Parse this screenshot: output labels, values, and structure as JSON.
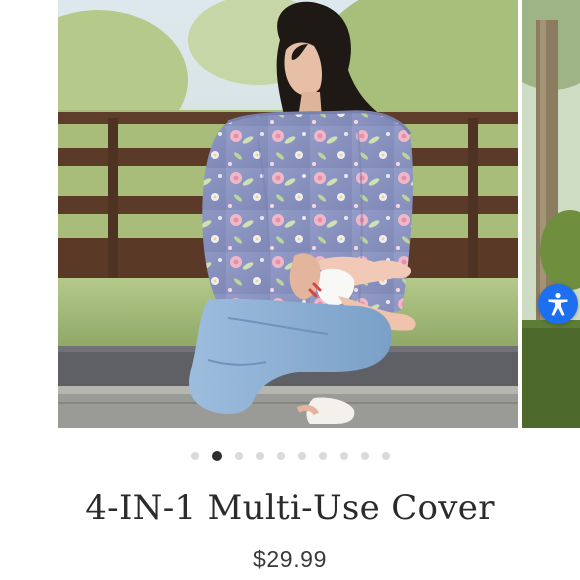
{
  "product": {
    "title": "4-IN-1 Multi-Use Cover",
    "price": "$29.99"
  },
  "carousel": {
    "slide_count": 10,
    "active_index": 1,
    "main_image": "woman-seated-nursing-cover-photo",
    "next_image": "tree-and-hedge-photo"
  },
  "accessibility_button": {
    "icon": "accessibility-icon",
    "color": "#1e6ff0"
  },
  "colors": {
    "cover_fabric": "#8e97c2",
    "flower_pink": "#eeb0c4",
    "leaf_green": "#c9dcb0",
    "fence_brown": "#5e3e2a",
    "jeans_blue": "#8fb3d6",
    "active_dot": "#2e2e2e",
    "inactive_dot": "#dadada"
  }
}
